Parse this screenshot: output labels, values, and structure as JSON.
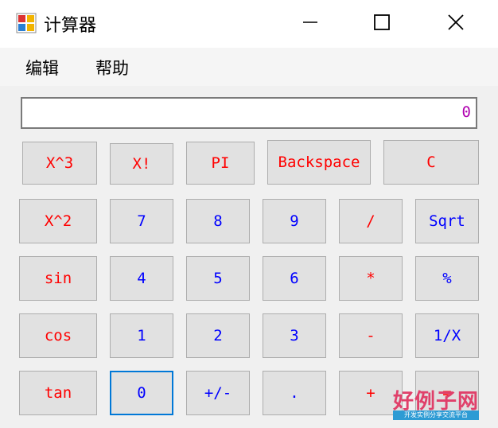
{
  "window": {
    "title": "计算器",
    "minimize_icon": "minimize-icon",
    "maximize_icon": "maximize-icon",
    "close_icon": "close-icon"
  },
  "menu": {
    "items": [
      {
        "label": "编辑"
      },
      {
        "label": "帮助"
      }
    ]
  },
  "display": {
    "value": "0"
  },
  "keys": {
    "row1": [
      {
        "label": "X^3"
      },
      {
        "label": "X!"
      },
      {
        "label": "PI"
      },
      {
        "label": "Backspace"
      },
      {
        "label": "C"
      }
    ],
    "row2": [
      {
        "label": "X^2"
      },
      {
        "label": "7"
      },
      {
        "label": "8"
      },
      {
        "label": "9"
      },
      {
        "label": "/"
      },
      {
        "label": "Sqrt"
      }
    ],
    "row3": [
      {
        "label": "sin"
      },
      {
        "label": "4"
      },
      {
        "label": "5"
      },
      {
        "label": "6"
      },
      {
        "label": "*"
      },
      {
        "label": "%"
      }
    ],
    "row4": [
      {
        "label": "cos"
      },
      {
        "label": "1"
      },
      {
        "label": "2"
      },
      {
        "label": "3"
      },
      {
        "label": "-"
      },
      {
        "label": "1/X"
      }
    ],
    "row5": [
      {
        "label": "tan"
      },
      {
        "label": "0"
      },
      {
        "label": "+/-"
      },
      {
        "label": "."
      },
      {
        "label": "+"
      },
      {
        "label": "="
      }
    ]
  },
  "colors": {
    "function_key": "#ff0000",
    "digit_key": "#0000ff",
    "display_text": "#b000b0",
    "focus_border": "#0078d7"
  },
  "watermark": {
    "brand": "好例子网",
    "tagline": "开发实例分享交流平台"
  }
}
